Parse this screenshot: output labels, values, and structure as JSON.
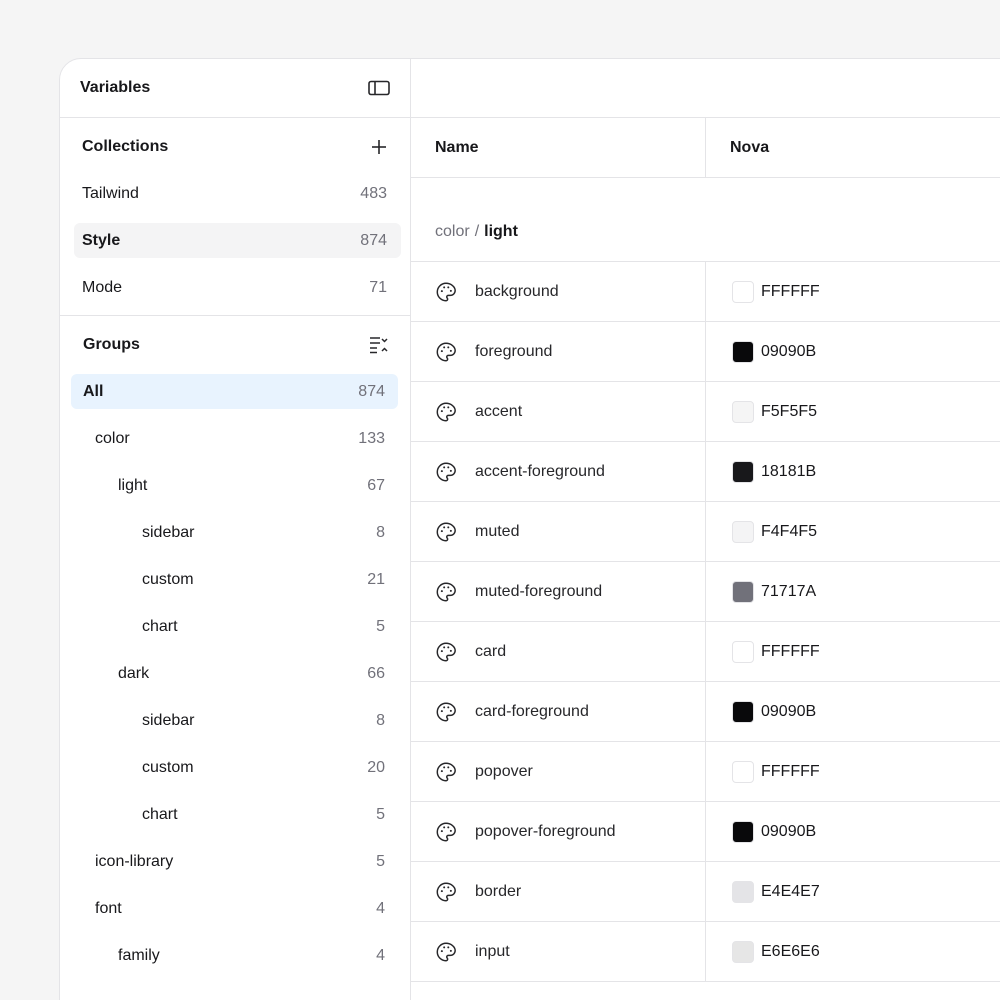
{
  "sidebar": {
    "title": "Variables",
    "collections": {
      "title": "Collections",
      "items": [
        {
          "label": "Tailwind",
          "count": "483",
          "selected": false
        },
        {
          "label": "Style",
          "count": "874",
          "selected": true
        },
        {
          "label": "Mode",
          "count": "71",
          "selected": false
        }
      ]
    },
    "groups": {
      "title": "Groups",
      "items": [
        {
          "label": "All",
          "count": "874",
          "level": 0,
          "active": true
        },
        {
          "label": "color",
          "count": "133",
          "level": 1
        },
        {
          "label": "light",
          "count": "67",
          "level": 2
        },
        {
          "label": "sidebar",
          "count": "8",
          "level": 3
        },
        {
          "label": "custom",
          "count": "21",
          "level": 3
        },
        {
          "label": "chart",
          "count": "5",
          "level": 3
        },
        {
          "label": "dark",
          "count": "66",
          "level": 2
        },
        {
          "label": "sidebar",
          "count": "8",
          "level": 3
        },
        {
          "label": "custom",
          "count": "20",
          "level": 3
        },
        {
          "label": "chart",
          "count": "5",
          "level": 3
        },
        {
          "label": "icon-library",
          "count": "5",
          "level": 1
        },
        {
          "label": "font",
          "count": "4",
          "level": 1
        },
        {
          "label": "family",
          "count": "4",
          "level": 2
        }
      ]
    }
  },
  "table": {
    "columns": {
      "name": "Name",
      "mode": "Nova"
    },
    "group_path": {
      "parent": "color",
      "separator": "/",
      "leaf": "light"
    },
    "rows": [
      {
        "name": "background",
        "value": "FFFFFF",
        "color": "#FFFFFF"
      },
      {
        "name": "foreground",
        "value": "09090B",
        "color": "#09090B"
      },
      {
        "name": "accent",
        "value": "F5F5F5",
        "color": "#F5F5F5"
      },
      {
        "name": "accent-foreground",
        "value": "18181B",
        "color": "#18181B"
      },
      {
        "name": "muted",
        "value": "F4F4F5",
        "color": "#F4F4F5"
      },
      {
        "name": "muted-foreground",
        "value": "71717A",
        "color": "#71717A"
      },
      {
        "name": "card",
        "value": "FFFFFF",
        "color": "#FFFFFF"
      },
      {
        "name": "card-foreground",
        "value": "09090B",
        "color": "#09090B"
      },
      {
        "name": "popover",
        "value": "FFFFFF",
        "color": "#FFFFFF"
      },
      {
        "name": "popover-foreground",
        "value": "09090B",
        "color": "#09090B"
      },
      {
        "name": "border",
        "value": "E4E4E7",
        "color": "#E4E4E7"
      },
      {
        "name": "input",
        "value": "E6E6E6",
        "color": "#E6E6E6"
      }
    ]
  },
  "icons": {
    "sidebar_toggle": "sidebar-toggle-icon",
    "add": "plus-icon",
    "groups_toggle": "collapse-list-icon",
    "variable": "palette-icon"
  },
  "colors": {
    "active_group_bg": "#E8F3FE",
    "selected_row_bg": "#F4F4F5",
    "border": "#E4E4E7"
  }
}
